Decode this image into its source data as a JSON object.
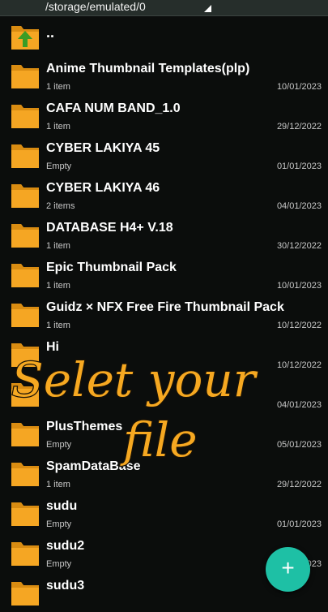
{
  "path": "/storage/emulated/0",
  "parent_label": "..",
  "files": [
    {
      "name": "Anime Thumbnail Templates(plp)",
      "meta": "1 item",
      "date": "10/01/2023"
    },
    {
      "name": "CAFA NUM BAND_1.0",
      "meta": "1 item",
      "date": "29/12/2022"
    },
    {
      "name": "CYBER LAKIYA 45",
      "meta": "Empty",
      "date": "01/01/2023"
    },
    {
      "name": "CYBER LAKIYA 46",
      "meta": "2 items",
      "date": "04/01/2023"
    },
    {
      "name": "DATABASE H4+ V.18",
      "meta": "1 item",
      "date": "30/12/2022"
    },
    {
      "name": "Epic Thumbnail Pack",
      "meta": "1 item",
      "date": "10/01/2023"
    },
    {
      "name": "Guidz × NFX  Free Fire Thumbnail Pack",
      "meta": "1 item",
      "date": "10/12/2022"
    },
    {
      "name": "Hi",
      "meta": "",
      "date": "10/12/2022"
    },
    {
      "name": "",
      "meta": "",
      "date": "04/01/2023"
    },
    {
      "name": "PlusThemes",
      "meta": "Empty",
      "date": "05/01/2023"
    },
    {
      "name": "SpamDataBase",
      "meta": "1 item",
      "date": "29/12/2022"
    },
    {
      "name": "sudu",
      "meta": "Empty",
      "date": "01/01/2023"
    },
    {
      "name": "sudu2",
      "meta": "Empty",
      "date": "04/01/2023"
    },
    {
      "name": "sudu3",
      "meta": "",
      "date": ""
    }
  ],
  "overlay_text": {
    "line1": "Selet your",
    "line2": "file"
  },
  "fab_icon": "plus-icon",
  "colors": {
    "folder": "#f5a623",
    "folder_tab": "#d98c12",
    "fab": "#1ec0a5",
    "overlay": "#f6a821"
  }
}
